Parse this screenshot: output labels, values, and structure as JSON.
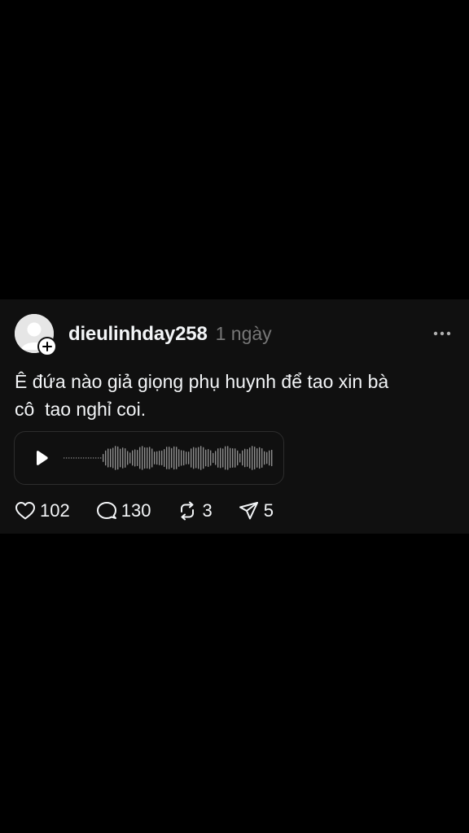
{
  "post": {
    "username": "dieulinhday258",
    "time": "1 ngày",
    "text": "Ê đứa nào giả giọng phụ huynh để tao xin bà\ncô  tao nghỉ coi.",
    "audio": {
      "type": "voice-note",
      "play_icon": "play-icon"
    },
    "stats": {
      "likes": "102",
      "comments": "130",
      "reposts": "3",
      "shares": "5"
    }
  },
  "icons": {
    "like": "heart-icon",
    "comment": "comment-bubble-icon",
    "repost": "repost-icon",
    "share": "send-icon",
    "more": "more-dots-icon",
    "follow": "plus-icon"
  },
  "colors": {
    "background": "#000000",
    "card": "#101010",
    "text": "#f3f5f7",
    "muted": "#777777",
    "border": "#2d2d2d"
  }
}
